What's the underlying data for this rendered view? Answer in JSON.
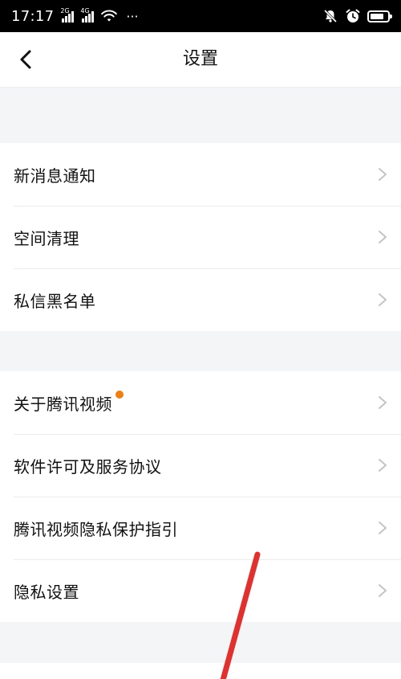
{
  "status_bar": {
    "time": "17:17",
    "network_1": "2G",
    "network_2": "4G",
    "more": "···",
    "battery_percent": 80
  },
  "header": {
    "title": "设置",
    "back_icon": "chevron-left-icon"
  },
  "sections": [
    {
      "items": [
        {
          "label": "新消息通知",
          "has_dot": false
        },
        {
          "label": "空间清理",
          "has_dot": false
        },
        {
          "label": "私信黑名单",
          "has_dot": false
        }
      ]
    },
    {
      "items": [
        {
          "label": "关于腾讯视频",
          "has_dot": true
        },
        {
          "label": "软件许可及服务协议",
          "has_dot": false
        },
        {
          "label": "腾讯视频隐私保护指引",
          "has_dot": false
        },
        {
          "label": "隐私设置",
          "has_dot": false
        }
      ]
    }
  ],
  "colors": {
    "badge": "#f07f13",
    "annotation": "#e2302f",
    "background": "#f4f5f7"
  }
}
